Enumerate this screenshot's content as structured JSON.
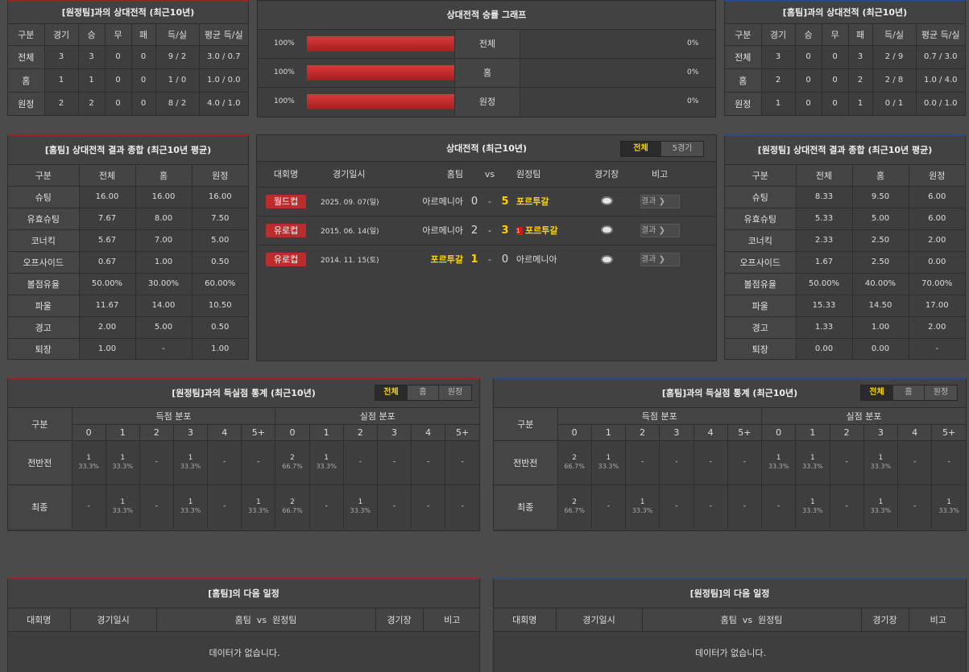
{
  "away_h2h": {
    "title": "[원정팀]과의 상대전적 (최근10년)",
    "headers": [
      "구분",
      "경기",
      "승",
      "무",
      "패",
      "득/실",
      "평균 득/실"
    ],
    "rows": [
      [
        "전체",
        "3",
        "3",
        "0",
        "0",
        "9 / 2",
        "3.0 / 0.7"
      ],
      [
        "홈",
        "1",
        "1",
        "0",
        "0",
        "1 / 0",
        "1.0 / 0.0"
      ],
      [
        "원정",
        "2",
        "2",
        "0",
        "0",
        "8 / 2",
        "4.0 / 1.0"
      ]
    ]
  },
  "graph": {
    "title": "상대전적 승률 그래프",
    "rows": [
      {
        "left": "100%",
        "label": "전체",
        "right": "0%",
        "fill": 1.0
      },
      {
        "left": "100%",
        "label": "홈",
        "right": "0%",
        "fill": 1.0
      },
      {
        "left": "100%",
        "label": "원정",
        "right": "0%",
        "fill": 1.0
      }
    ]
  },
  "home_h2h": {
    "title": "[홈팀]과의 상대전적 (최근10년)",
    "headers": [
      "구분",
      "경기",
      "승",
      "무",
      "패",
      "득/실",
      "평균 득/실"
    ],
    "rows": [
      [
        "전체",
        "3",
        "0",
        "0",
        "3",
        "2 / 9",
        "0.7 / 3.0"
      ],
      [
        "홈",
        "2",
        "0",
        "0",
        "2",
        "2 / 8",
        "1.0 / 4.0"
      ],
      [
        "원정",
        "1",
        "0",
        "0",
        "1",
        "0 / 1",
        "0.0 / 1.0"
      ]
    ]
  },
  "home_summary": {
    "title": "[홈팀] 상대전적 결과 종합 (최근10년 평균)",
    "headers": [
      "구분",
      "전체",
      "홈",
      "원정"
    ],
    "rows": [
      [
        "슈팅",
        "16.00",
        "16.00",
        "16.00"
      ],
      [
        "유효슈팅",
        "7.67",
        "8.00",
        "7.50"
      ],
      [
        "코너킥",
        "5.67",
        "7.00",
        "5.00"
      ],
      [
        "오프사이드",
        "0.67",
        "1.00",
        "0.50"
      ],
      [
        "볼점유율",
        "50.00%",
        "30.00%",
        "60.00%"
      ],
      [
        "파울",
        "11.67",
        "14.00",
        "10.50"
      ],
      [
        "경고",
        "2.00",
        "5.00",
        "0.50"
      ],
      [
        "퇴장",
        "1.00",
        "-",
        "1.00"
      ]
    ]
  },
  "matches": {
    "title": "상대전적 (최근10년)",
    "tabs": [
      "전체",
      "5경기"
    ],
    "headers": {
      "comp": "대회명",
      "date": "경기일시",
      "home": "홈팀",
      "vs": "vs",
      "away": "원정팀",
      "venue": "경기장",
      "note": "비고"
    },
    "rows": [
      {
        "comp": "월드컵",
        "date": "2025. 09. 07(일)",
        "home": "아르메니아",
        "hs": "0",
        "sep": "-",
        "as": "5",
        "away": "포르투갈",
        "card": "",
        "result": "결과 ❯",
        "winner": "away"
      },
      {
        "comp": "유로컵",
        "date": "2015. 06. 14(일)",
        "home": "아르메니아",
        "hs": "2",
        "sep": "-",
        "as": "3",
        "away": "포르투갈",
        "card": "1",
        "result": "결과 ❯",
        "winner": "away"
      },
      {
        "comp": "유로컵",
        "date": "2014. 11. 15(토)",
        "home": "포르투갈",
        "hs": "1",
        "sep": "-",
        "as": "0",
        "away": "아르메니아",
        "card": "",
        "result": "결과 ❯",
        "winner": "home"
      }
    ]
  },
  "away_summary": {
    "title": "[원정팀] 상대전적 결과 종합 (최근10년 평균)",
    "headers": [
      "구분",
      "전체",
      "홈",
      "원정"
    ],
    "rows": [
      [
        "슈팅",
        "8.33",
        "9.50",
        "6.00"
      ],
      [
        "유효슈팅",
        "5.33",
        "5.00",
        "6.00"
      ],
      [
        "코너킥",
        "2.33",
        "2.50",
        "2.00"
      ],
      [
        "오프사이드",
        "1.67",
        "2.50",
        "0.00"
      ],
      [
        "볼점유율",
        "50.00%",
        "40.00%",
        "70.00%"
      ],
      [
        "파울",
        "15.33",
        "14.50",
        "17.00"
      ],
      [
        "경고",
        "1.33",
        "1.00",
        "2.00"
      ],
      [
        "퇴장",
        "0.00",
        "0.00",
        "-"
      ]
    ]
  },
  "goals_left": {
    "title": "[원정팀]과의 득실점 통계 (최근10년)",
    "tabs": [
      "전체",
      "홈",
      "원정"
    ],
    "group_label": "구분",
    "scored": "득점 분포",
    "conceded": "실점 분포",
    "cols": [
      "0",
      "1",
      "2",
      "3",
      "4",
      "5+"
    ],
    "rows": [
      {
        "label": "전반전",
        "cells": [
          [
            "1",
            "33.3%"
          ],
          [
            "1",
            "33.3%"
          ],
          [
            "-",
            ""
          ],
          [
            "1",
            "33.3%"
          ],
          [
            "-",
            ""
          ],
          [
            "-",
            ""
          ],
          [
            "2",
            "66.7%"
          ],
          [
            "1",
            "33.3%"
          ],
          [
            "-",
            ""
          ],
          [
            "-",
            ""
          ],
          [
            "-",
            ""
          ],
          [
            "-",
            ""
          ]
        ]
      },
      {
        "label": "최종",
        "cells": [
          [
            "-",
            ""
          ],
          [
            "1",
            "33.3%"
          ],
          [
            "-",
            ""
          ],
          [
            "1",
            "33.3%"
          ],
          [
            "-",
            ""
          ],
          [
            "1",
            "33.3%"
          ],
          [
            "2",
            "66.7%"
          ],
          [
            "-",
            ""
          ],
          [
            "1",
            "33.3%"
          ],
          [
            "-",
            ""
          ],
          [
            "-",
            ""
          ],
          [
            "-",
            ""
          ]
        ]
      }
    ]
  },
  "goals_right": {
    "title": "[홈팀]과의 득실점 통계 (최근10년)",
    "tabs": [
      "전체",
      "홈",
      "원정"
    ],
    "group_label": "구분",
    "scored": "득점 분포",
    "conceded": "실점 분포",
    "cols": [
      "0",
      "1",
      "2",
      "3",
      "4",
      "5+"
    ],
    "rows": [
      {
        "label": "전반전",
        "cells": [
          [
            "2",
            "66.7%"
          ],
          [
            "1",
            "33.3%"
          ],
          [
            "-",
            ""
          ],
          [
            "-",
            ""
          ],
          [
            "-",
            ""
          ],
          [
            "-",
            ""
          ],
          [
            "1",
            "33.3%"
          ],
          [
            "1",
            "33.3%"
          ],
          [
            "-",
            ""
          ],
          [
            "1",
            "33.3%"
          ],
          [
            "-",
            ""
          ],
          [
            "-",
            ""
          ]
        ]
      },
      {
        "label": "최종",
        "cells": [
          [
            "2",
            "66.7%"
          ],
          [
            "-",
            ""
          ],
          [
            "1",
            "33.3%"
          ],
          [
            "-",
            ""
          ],
          [
            "-",
            ""
          ],
          [
            "-",
            ""
          ],
          [
            "-",
            ""
          ],
          [
            "1",
            "33.3%"
          ],
          [
            "-",
            ""
          ],
          [
            "1",
            "33.3%"
          ],
          [
            "-",
            ""
          ],
          [
            "1",
            "33.3%"
          ]
        ]
      }
    ]
  },
  "next_home": {
    "title": "[홈팀]의 다음 일정",
    "headers": [
      "대회명",
      "경기일시",
      "홈팀  vs  원정팀",
      "경기장",
      "비고"
    ],
    "empty": "데이터가 없습니다."
  },
  "next_away": {
    "title": "[원정팀]의 다음 일정",
    "headers": [
      "대회명",
      "경기일시",
      "홈팀  vs  원정팀",
      "경기장",
      "비고"
    ],
    "empty": "데이터가 없습니다."
  },
  "colors": {
    "bar": "#c42a2a",
    "highlight": "#ffd200",
    "badge": "#b92d2d"
  }
}
